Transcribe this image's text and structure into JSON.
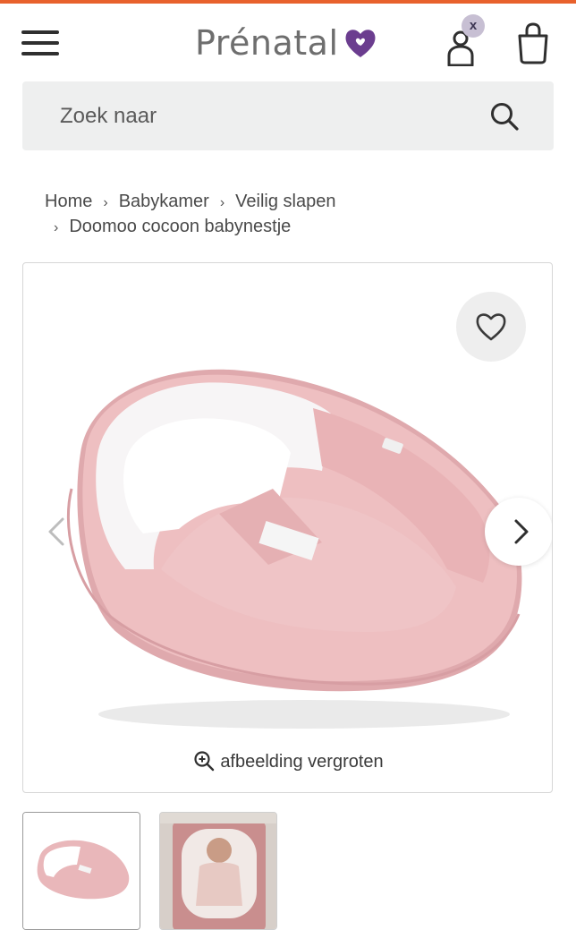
{
  "header": {
    "logo_text": "Prénatal",
    "account_badge": "x",
    "accent_color": "#e8612c",
    "brand_purple": "#6b3d8f",
    "icons": [
      "menu-icon",
      "heart-logo-icon",
      "account-icon",
      "shopping-bag-icon"
    ]
  },
  "search": {
    "placeholder": "Zoek naar",
    "icon": "search-icon"
  },
  "breadcrumb": {
    "items": [
      "Home",
      "Babykamer",
      "Veilig slapen",
      "Doomoo cocoon babynestje"
    ],
    "separator": "›"
  },
  "gallery": {
    "zoom_label": "afbeelding vergroten",
    "icons": [
      "heart-outline-icon",
      "chevron-left-icon",
      "chevron-right-icon",
      "zoom-in-icon"
    ],
    "thumbnail_count": 2,
    "selected_thumbnail": 1,
    "product_color": "#e8bcbe"
  }
}
